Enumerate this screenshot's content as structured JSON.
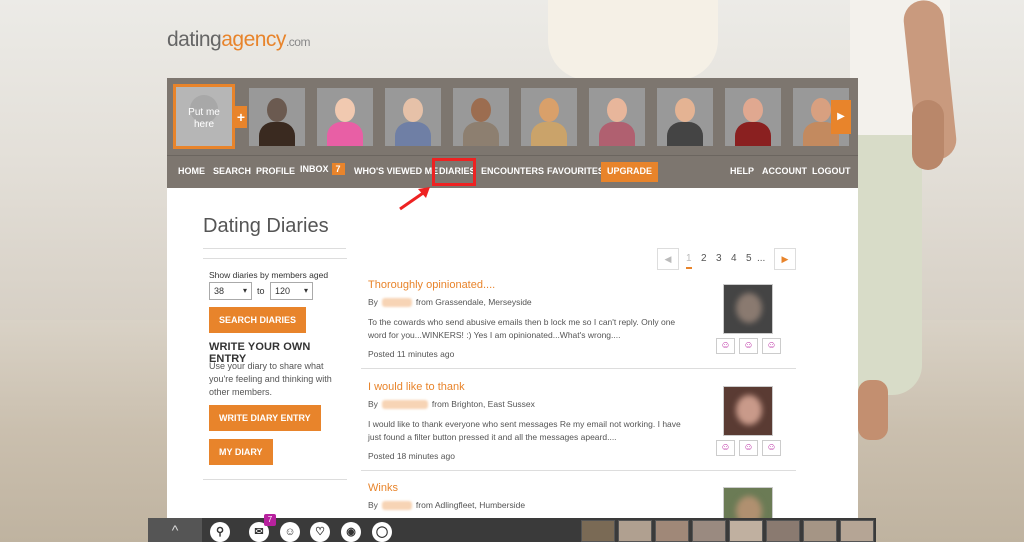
{
  "logo": {
    "main": "dating",
    "accent": "agency",
    "tld": ".com"
  },
  "profile_strip": {
    "put_me_here": "Put me here",
    "plus": "+",
    "next": "▶",
    "thumbs": [
      {
        "face": "#6b5a50",
        "body": "#3a2a20"
      },
      {
        "face": "#f1c9b0",
        "body": "#e85fa5"
      },
      {
        "face": "#e6c1a8",
        "body": "#6f7fa5"
      },
      {
        "face": "#9c6d50",
        "body": "#8d7f70"
      },
      {
        "face": "#d9a06a",
        "body": "#caa36a"
      },
      {
        "face": "#e8b69b",
        "body": "#b06070"
      },
      {
        "face": "#e4b393",
        "body": "#444"
      },
      {
        "face": "#e0a890",
        "body": "#8a2020"
      },
      {
        "face": "#d8a080",
        "body": "#c38a5f"
      }
    ]
  },
  "nav": {
    "home": "HOME",
    "search": "SEARCH",
    "profile": "PROFILE",
    "inbox": "INBOX",
    "inbox_count": "7",
    "whos_viewed": "WHO'S VIEWED ME",
    "diaries": "DIARIES",
    "encounters": "ENCOUNTERS",
    "favourites": "FAVOURITES",
    "upgrade": "UPGRADE",
    "help": "HELP",
    "account": "ACCOUNT",
    "logout": "LOGOUT"
  },
  "page": {
    "title": "Dating Diaries"
  },
  "sidebar": {
    "age_label": "Show diaries by members aged",
    "age_from": "38",
    "age_to_label": "to",
    "age_to": "120",
    "search_button": "SEARCH DIARIES",
    "heading": "WRITE YOUR OWN ENTRY",
    "text": "Use your diary to share what you're feeling and thinking with other members.",
    "write_button": "WRITE DIARY ENTRY",
    "my_diary_button": "MY DIARY"
  },
  "pager": {
    "prev": "◀",
    "pages": [
      "1",
      "2",
      "3",
      "4",
      "5"
    ],
    "ellipsis": "...",
    "next": "▶"
  },
  "entries": [
    {
      "title": "Thoroughly opinionated....",
      "by": "By",
      "location": "from Grassendale, Merseyside",
      "body": "To the cowards who send abusive emails then b lock me so I can't reply. Only one word for you...WINKERS! :) Yes I am opinionated...What's wrong....",
      "posted": "Posted 11 minutes ago"
    },
    {
      "title": "I would like to thank",
      "by": "By",
      "location": "from Brighton, East Sussex",
      "body": "I would like to thank everyone who sent messages Re my email not working. I have just found a filter button pressed it and all the messages apeard....",
      "posted": "Posted 18 minutes ago"
    },
    {
      "title": "Winks",
      "by": "By",
      "location": "from Adlingfleet, Humberside",
      "body": "",
      "posted": ""
    }
  ],
  "reaction_icons": [
    "☺",
    "☺",
    "☺"
  ],
  "bottombar": {
    "logo": "^",
    "badge": "7",
    "icons": [
      "search-icon",
      "mail-icon",
      "smile-icon",
      "heart-icon",
      "eye-icon",
      "chat-icon"
    ],
    "glyphs": [
      "⚲",
      "✉",
      "☺",
      "♡",
      "◉",
      "◯"
    ]
  }
}
